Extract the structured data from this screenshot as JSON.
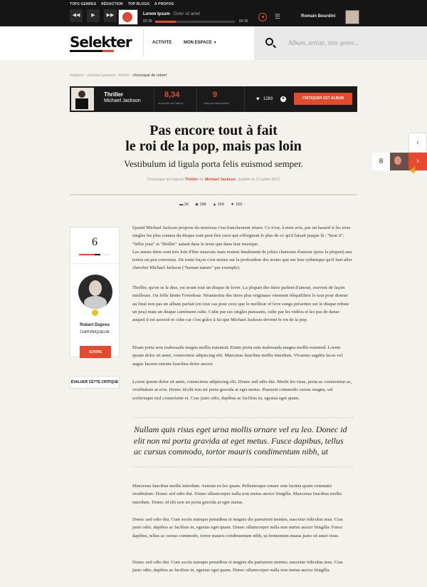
{
  "topnav": [
    "TOPS GENRES",
    "RÉDACTION",
    "TOP BLOGS",
    "À PROPOS"
  ],
  "player": {
    "prev_icon": "prev-icon",
    "play_icon": "play-icon",
    "next_icon": "next-icon",
    "track_title": "Lorem Ipsum",
    "track_sep": " - ",
    "track_sub": "Dolor sit amet",
    "time_elapsed": "02:39",
    "time_total": "05:36",
    "progress": 0.26,
    "volume_icon": "volume-icon",
    "playlist_icon": "list-icon"
  },
  "user": {
    "name": "Romain Bourdini"
  },
  "header": {
    "logo": "Selekter",
    "nav_activite": "ACTIVITE",
    "nav_espace": "MON ESPACE",
    "search_placeholder": "Album, artiste, titre genre..."
  },
  "breadcrumb": [
    "explorer",
    "michael jackson",
    "thriller",
    "chronique de robert"
  ],
  "album": {
    "title": "Thriller",
    "artist": "Michael Jackson",
    "average": "8,34",
    "average_label": "moyenne de l'album",
    "critiques": "9",
    "critiques_label": "critiques disponibles",
    "likes": "1283",
    "critique_button": "CRITIQUER CET ALBUM"
  },
  "article": {
    "title_line1": "Pas encore tout à fait",
    "title_line2": "le roi de la pop, mais pas loin",
    "subtitle": "Vestibulum id ligula porta felis euismod semper.",
    "meta_prefix": "Chronique de l'album",
    "meta_album": "Thriller",
    "meta_de": "de",
    "meta_artist": "Michael Jackson",
    "meta_suffix": ", publiée le 12 juillet 2012",
    "stats": {
      "comments": "26",
      "views": "188",
      "likes": "169",
      "dislikes": "169"
    },
    "p1a": "Quand Michael Jackson propose du nouveau c'est franchement réussi. Ce n'est, à mon avis, pas un hasard si les trois singles les plus connus du disque sont peut être ceux qui s'éloignent le plus de ce qu'il faisait jusque là : \"beat it\", \"billie jean\" et \"thriller\" autant dans le texte que dans leur musique.",
    "p1b": "Les autres titres sont très loin d'être mauvais mais restent finalement de jolies chansons d'amour (pour la plupart) aux textes un peu convenus. De toute façon c'est moins sur la profondeur des textes que sur leur rythmique qu'il faut aller chercher Michael Jackson (\"human nature\" par exemple).",
    "p2": "Thriller, qu'on se le dise, est avant tout un disque de lover. La plupart des titres parlent d'amour, souvent de façon mielleuse. On frôle limite l'overdose. Néanmoins des titres plus originaux viennent rééquilibrer le tout pour donner au final non pas un album parfait (en tout cas pour ceux que le meilleur of love songs présentes sur le disque rebute un peu) mais un disque carrément culte. Culte par ses singles puissants, culte par les vidéos et les pas de danse auquel il est associé et culte car c'est grâce à lui que Michael Jackson devient le roi de la pop.",
    "p3": "Etiam porta sem malesuada magna mollis euismod. Etiam porta sem malesuada magna mollis euismod. Lorem ipsum dolor sit amet, consectetur adipiscing elit. Maecenas faucibus mollis interdum. Vivamus sagittis lacus vel augue laoreet rutrum faucibus dolor auctor.",
    "p4": "Lorem ipsum dolor sit amet, consectetur adipiscing elit. Donec sed odio dui. Morbi leo risus, porta ac consectetur ac, vestibulum at eros. Donec id elit non mi porta gravida at eget metus. Praesent commodo cursus magna, vel scelerisque nisl consectetur et. Cras justo odio, dapibus ac facilisis in, egestas eget quam.",
    "quote": "Nullam quis risus eget urna mollis ornare vel eu leo. Donec id elit non mi porta gravida at eget metus. Fusce dapibus, tellus ac cursus commodo, tortor mauris condimentum nibh, ut",
    "p5": "Maecenas faucibus mollis interdum. Aenean eu leo quam. Pellentesque ornare sem lacinia quam venenatis vestibulum. Donec sed odio dui. Donec ullamcorper nulla non metus auctor fringilla. Maecenas faucibus mollis interdum. Donec id elit non mi porta gravida at eget metus.",
    "p6": "Donec sed odio dui. Cum sociis natoque penatibus et magnis dis parturient montes, nascetur ridiculus mus. Cras justo odio, dapibus ac facilisis in, egestas eget quam. Donec ullamcorper nulla non metus auctor fringilla. Fusce dapibus, tellus ac cursus commodo, tortor mauris condimentum nibh, ut fermentum massa justo sit amet risus.",
    "p7": "Donec sed odio dui. Cum sociis natoque penatibus et magnis dis parturient montes, nascetur ridiculus mus. Cras justo odio, dapibus ac facilisis in, egestas eget quam. Donec ullamcorper nulla non metus auctor fringilla."
  },
  "reviewer": {
    "score": "6",
    "score_fraction": 0.6,
    "name": "Robert Dupres",
    "role": "CHRONIQUEUR",
    "follow_button": "SUIVRE",
    "evaluate_button": "ÉVALUER CETTE CRITIQUE"
  },
  "side": {
    "next_score": "8"
  }
}
